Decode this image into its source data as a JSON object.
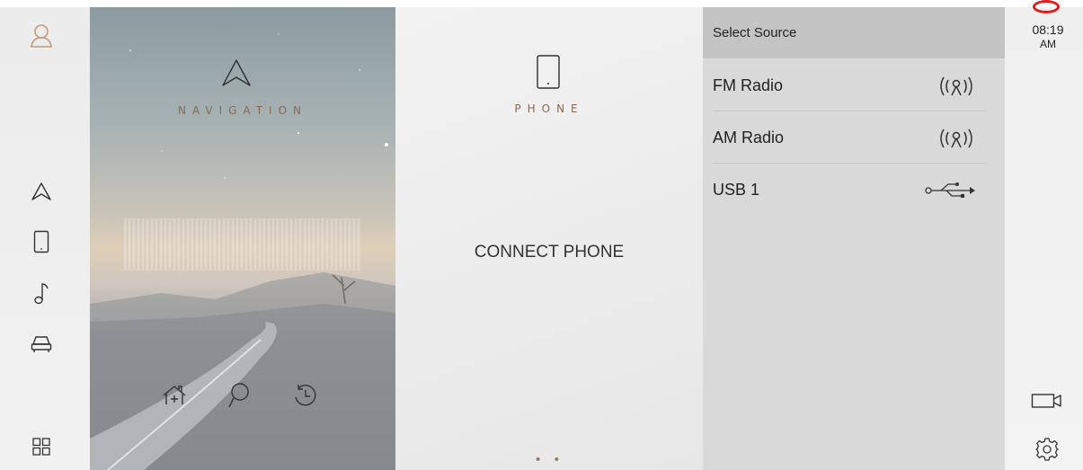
{
  "left_rail": {
    "icons": [
      "profile-icon",
      "navigation-arrow-icon",
      "phone-icon",
      "music-note-icon",
      "car-icon",
      "apps-grid-icon"
    ]
  },
  "navigation": {
    "title": "NAVIGATION",
    "actions": [
      "home-add-icon",
      "search-icon",
      "history-icon"
    ]
  },
  "phone": {
    "title": "PHONE",
    "connect_label": "CONNECT PHONE",
    "pager": "• • •"
  },
  "source_panel": {
    "header": "Select Source",
    "items": [
      {
        "label": "FM Radio",
        "icon": "radio-wave-icon"
      },
      {
        "label": "AM Radio",
        "icon": "radio-wave-icon"
      },
      {
        "label": "USB 1",
        "icon": "usb-icon"
      }
    ]
  },
  "status": {
    "time": "08:19",
    "ampm": "AM"
  },
  "colors": {
    "accent": "#8a6a52",
    "icon": "#333333",
    "record": "#e01b1b"
  }
}
